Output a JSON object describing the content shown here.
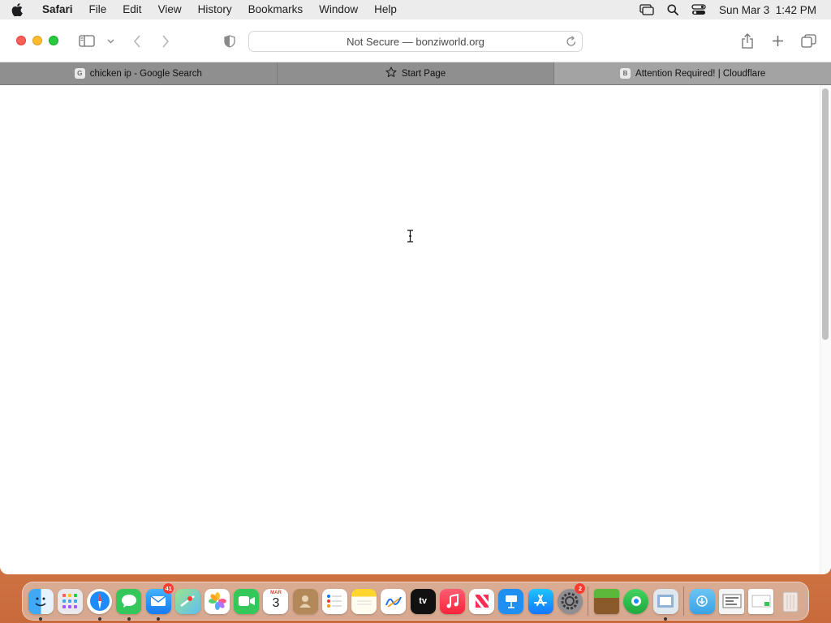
{
  "menubar": {
    "app_name": "Safari",
    "items": [
      "File",
      "Edit",
      "View",
      "History",
      "Bookmarks",
      "Window",
      "Help"
    ],
    "datetime": "Sun Mar 3  1:42 PM"
  },
  "toolbar": {
    "address_text": "Not Secure — bonziworld.org"
  },
  "tabs": [
    {
      "label": "chicken ip - Google Search",
      "favicon": "G"
    },
    {
      "label": "Start Page",
      "favicon": "star-icon"
    },
    {
      "label": "Attention Required! | Cloudflare",
      "favicon": "B"
    }
  ],
  "dock": {
    "mail_badge": "41",
    "settings_badge": "2",
    "calendar": {
      "month": "MAR",
      "day": "3"
    },
    "tv_label": "tv",
    "apps": [
      "finder",
      "launchpad",
      "safari",
      "messages",
      "mail",
      "maps",
      "photos",
      "facetime",
      "calendar",
      "contacts",
      "reminders",
      "notes",
      "freeform",
      "tv",
      "music",
      "news",
      "keynote",
      "app-store",
      "system-settings",
      "minecraft",
      "find-my",
      "preview",
      "downloads",
      "screenshots",
      "clipboard",
      "trash"
    ]
  },
  "colors": {
    "accent": "#0a84ff",
    "close": "#fe5f57",
    "minimize": "#febc2e",
    "maximize": "#28c840"
  }
}
